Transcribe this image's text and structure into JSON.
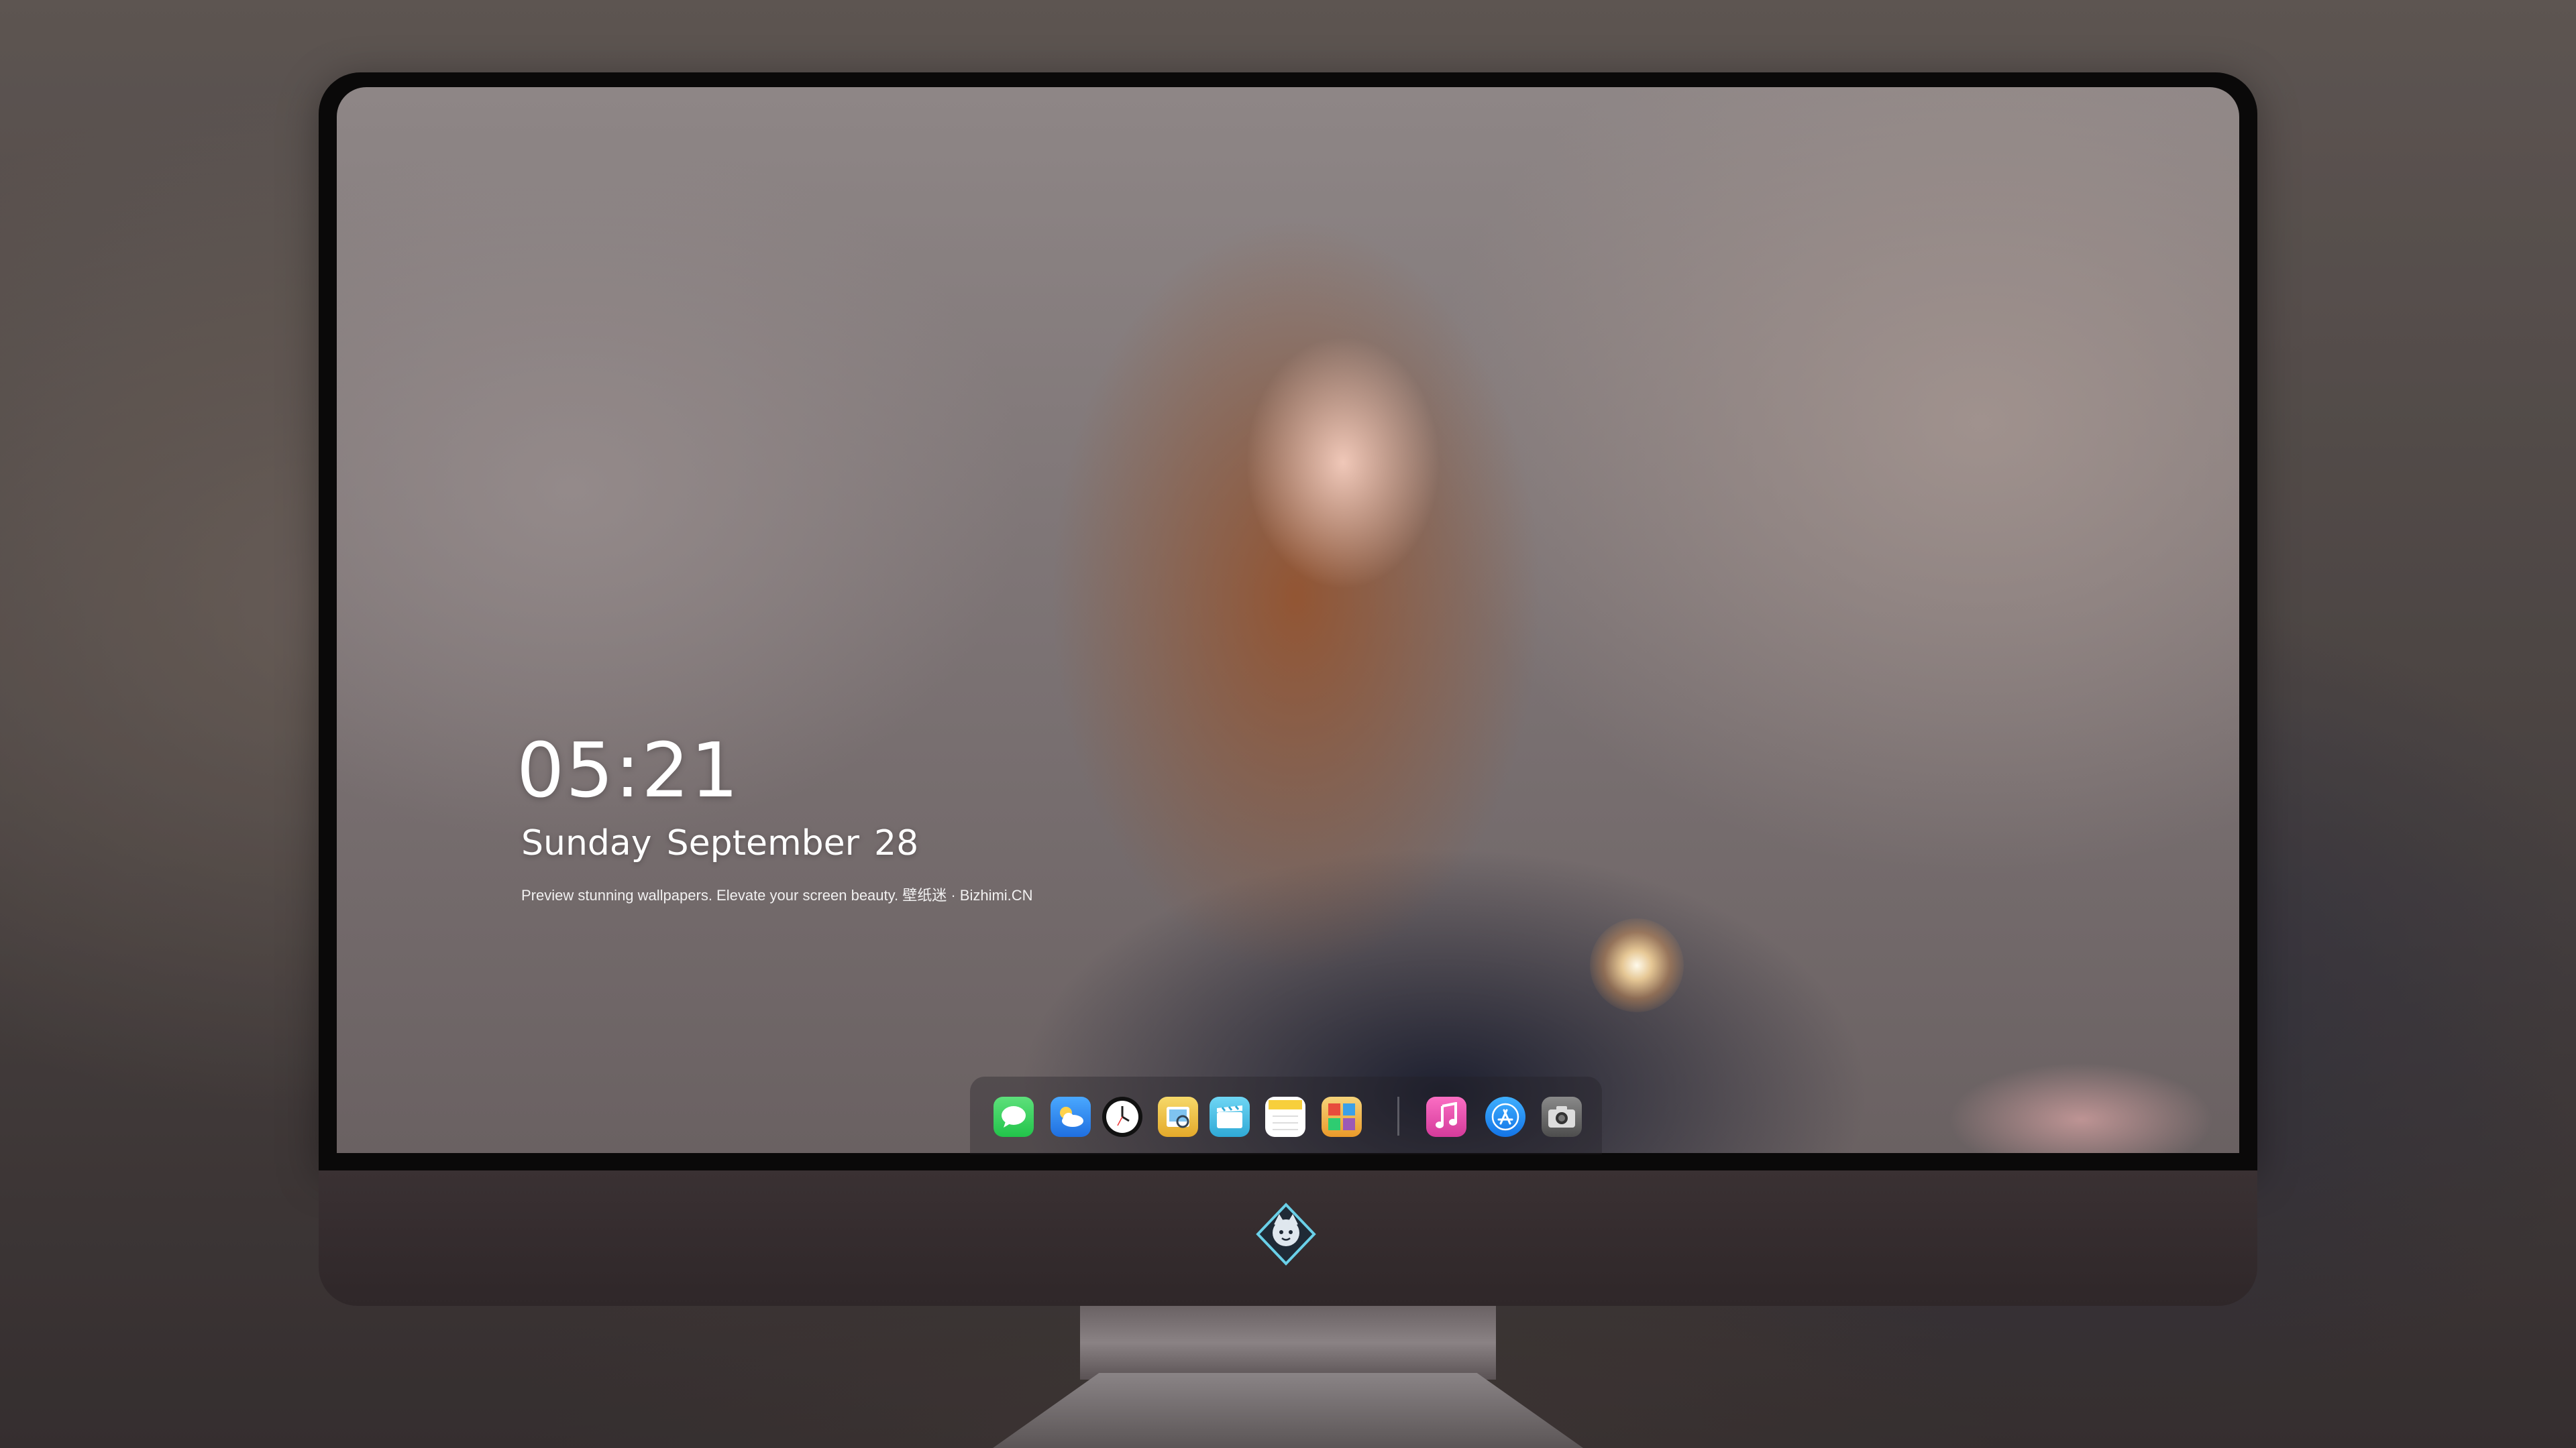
{
  "lock_screen": {
    "time": "05:21",
    "weekday": "Sunday",
    "month": "September",
    "day": "28",
    "tagline": "Preview stunning wallpapers. Elevate your screen beauty. 壁纸迷 · Bizhimi.CN"
  },
  "dock": {
    "apps": [
      {
        "name": "Messages",
        "icon": "messages-icon",
        "color": "#2fd158"
      },
      {
        "name": "Weather",
        "icon": "weather-icon",
        "color": "#2f8ef5"
      },
      {
        "name": "Clock",
        "icon": "clock-icon",
        "color": "#000000"
      },
      {
        "name": "Preview",
        "icon": "preview-icon",
        "color": "#f2c94c"
      },
      {
        "name": "Clips",
        "icon": "clips-icon",
        "color": "#4bc3e8"
      },
      {
        "name": "Notes",
        "icon": "notes-icon",
        "color": "#f7d64a"
      },
      {
        "name": "Photo Booth",
        "icon": "photo-booth-icon",
        "color": "#f2b134"
      },
      {
        "name": "Music",
        "icon": "music-icon",
        "color": "#f24aa8"
      },
      {
        "name": "App Store",
        "icon": "app-store-icon",
        "color": "#1a8cf5"
      },
      {
        "name": "Camera",
        "icon": "camera-icon",
        "color": "#6b6b6b"
      }
    ]
  },
  "colors": {
    "bezel": "#0a0909",
    "chin": "#342c2e",
    "text": "#ffffff"
  }
}
